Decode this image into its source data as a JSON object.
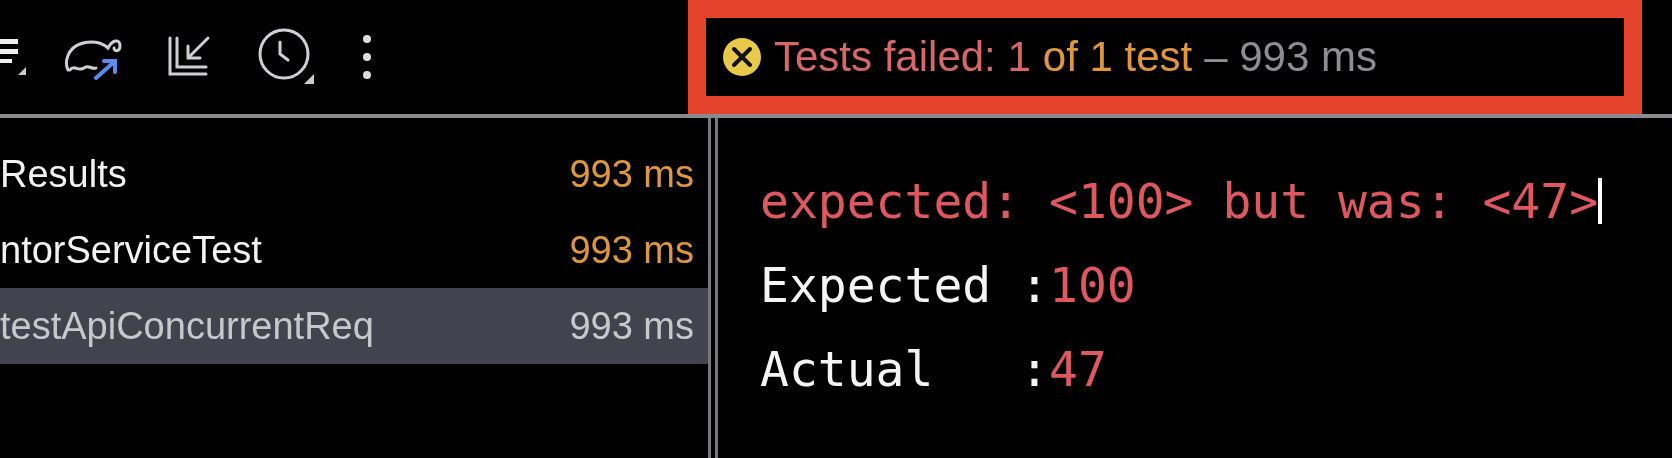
{
  "toolbar": {
    "icons": [
      {
        "kind": "list"
      },
      {
        "kind": "import"
      },
      {
        "kind": "collapse"
      },
      {
        "kind": "history"
      },
      {
        "kind": "more"
      }
    ]
  },
  "status": {
    "highlighted": true,
    "segments": [
      {
        "text": "Tests failed: 1",
        "kind": "failed"
      },
      {
        "text": "of 1 test",
        "kind": "count"
      },
      {
        "text": "– 993 ms",
        "kind": "duration"
      }
    ]
  },
  "tree": {
    "rows": [
      {
        "name": "Results",
        "duration": "993 ms",
        "selected": false
      },
      {
        "name": "ntorServiceTest",
        "duration": "993 ms",
        "selected": false
      },
      {
        "name": "testApiConcurrentReq",
        "duration": "993 ms",
        "selected": true
      }
    ]
  },
  "console": {
    "lines": [
      {
        "kind": "error",
        "text": "expected: <100> but was: <47>",
        "cursor": true
      },
      {
        "kind": "pair",
        "label": "Expected :",
        "value": "100"
      },
      {
        "kind": "pair",
        "label": "Actual   :",
        "value": "47"
      }
    ]
  }
}
